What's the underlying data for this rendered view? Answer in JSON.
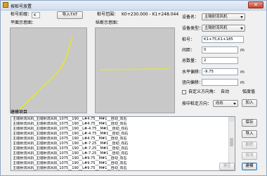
{
  "window": {
    "title": "按桩号放置",
    "close_glyph": "✕"
  },
  "stake": {
    "label": "桩号前缀：",
    "value": "K",
    "import_button": "导入TXT",
    "range_label": "桩号范围：",
    "range_value": "K0+230.000 - K1+248.044"
  },
  "plan_view": {
    "label": "平面示意图："
  },
  "profile_view": {
    "label": "纵断示意图："
  },
  "form": {
    "equipment_name_label": "设备名：",
    "equipment_name_value": "主隧射流风机",
    "equipment_type_label": "设备类型：",
    "equipment_type_value": "主隧射流风机",
    "stake_no_label": "桩号：",
    "stake_no_value": "K1+75,K1+185",
    "spacing_label": "间距：",
    "spacing_value": "0",
    "spacing_unit": "m",
    "total_label": "总数量：",
    "total_value": "2",
    "h_offset_label": "水平偏移：",
    "h_offset_value": "-9.75",
    "h_offset_unit": "m",
    "v_offset_label": "竖向偏移：",
    "v_offset_value": "",
    "v_offset_unit": "m",
    "custom_dir_label": "自定义方向角：",
    "custom_dir_value": "自动",
    "radian_label": "弧度值",
    "arrange_label": "按中桩走方向：",
    "arrange_value": "向右",
    "add_button": "加入"
  },
  "records": {
    "label": "建模项目",
    "rows": [
      "主隧射流风机_主隧射流风机_1075__190__L#4.75__M#1__自动_向右",
      "主隧射流风机_主隧射流风机_1075__190__L#4.75__M#1__自动_向右",
      "主隧射流风机_主隧射流风机_1075__190__L#-4.75__M#1__自动_向右",
      "主隧射流风机_主隧射流风机_1075__190__L#-4.75__M#1__自动_向右",
      "主隧射流风机_主隧射流风机_1075__190__L#4.75__M#1__自动_向右",
      "主隧射流风机_主隧射流风机_1075__190__L#-7.25__M#1__自动_向右",
      "主隧射流风机_主隧射流风机_1075__190__L#-7.25__M#1__自动_向右",
      "主隧射流风机_主隧射流风机_1075__190__L#-7.25__M#1__自动_向右",
      "主隧射流风机_主隧射流风机_1075__190__L#9.75__M#1__自动_向右",
      "主隧射流风机_主隧射流风机_1075__190__L#9.75__M#1__自动_向右",
      "主隧射流风机_主隧射流风机_1075__190__L#9.75__M#1__自动_向右"
    ]
  },
  "side_buttons": {
    "save": "保存",
    "import": "导入",
    "delete": "删除",
    "modify": "修改",
    "clear": "清空",
    "model": "建模"
  },
  "colors": {
    "curve": "#e6e62a",
    "canvas_bg": "#c8c8c8"
  }
}
